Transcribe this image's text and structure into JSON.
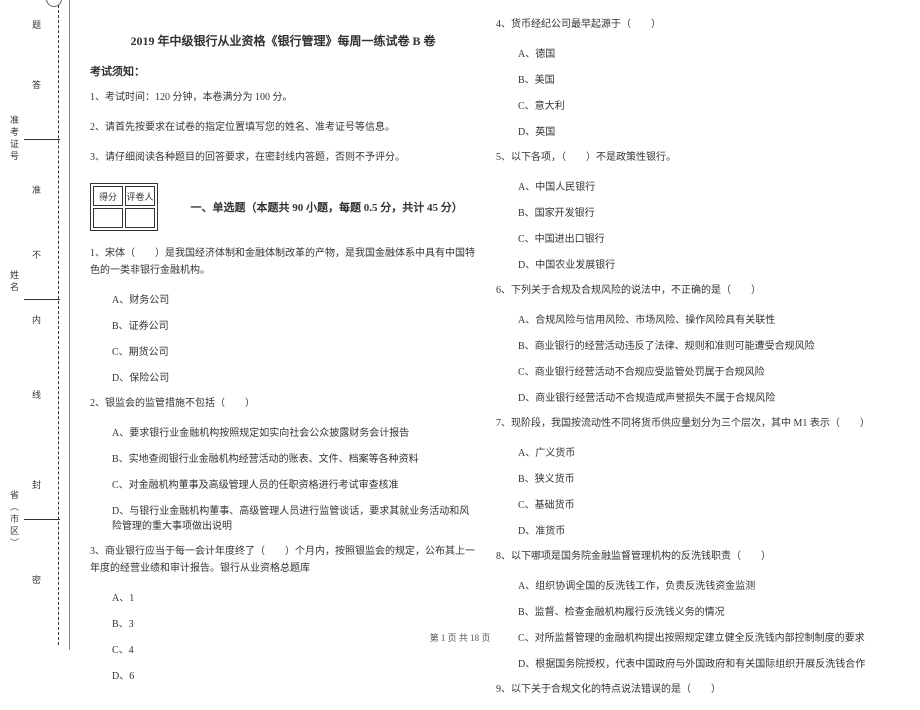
{
  "margin": {
    "field_pass": "准考证号",
    "field_name": "姓名",
    "field_region": "省（市区）",
    "seal": "密",
    "seal2": "封",
    "seal3": "线",
    "seal4": "内",
    "seal5": "不",
    "seal6": "准",
    "seal7": "答",
    "seal8": "题"
  },
  "title": "2019 年中级银行从业资格《银行管理》每周一练试卷 B 卷",
  "notice_label": "考试须知：",
  "notice1": "1、考试时间：120 分钟，本卷满分为 100 分。",
  "notice2": "2、请首先按要求在试卷的指定位置填写您的姓名、准考证号等信息。",
  "notice3": "3、请仔细阅读各种题目的回答要求，在密封线内答题，否则不予评分。",
  "score_h1": "得分",
  "score_h2": "评卷人",
  "section1": "一、单选题（本题共 90 小题，每题 0.5 分，共计 45 分）",
  "q1": "1、宋体（　　）是我国经济体制和金融体制改革的产物，是我国金融体系中具有中国特色的一类非银行金融机构。",
  "q1a": "A、财务公司",
  "q1b": "B、证券公司",
  "q1c": "C、期货公司",
  "q1d": "D、保险公司",
  "q2": "2、银监会的监管措施不包括（　　）",
  "q2a": "A、要求银行业金融机构按照规定如实向社会公众披露财务会计报告",
  "q2b": "B、实地查阅银行业金融机构经营活动的账表、文件、档案等各种资料",
  "q2c": "C、对金融机构董事及高级管理人员的任职资格进行考试审查核准",
  "q2d": "D、与银行业金融机构董事、高级管理人员进行监管谈话，要求其就业务活动和风险管理的重大事项做出说明",
  "q3": "3、商业银行应当于每一会计年度终了（　　）个月内，按照银监会的规定，公布其上一年度的经营业绩和审计报告。银行从业资格总题库",
  "q3a": "A、1",
  "q3b": "B、3",
  "q3c": "C、4",
  "q3d": "D、6",
  "q4": "4、货币经纪公司最早起源于（　　）",
  "q4a": "A、德国",
  "q4b": "B、美国",
  "q4c": "C、意大利",
  "q4d": "D、英国",
  "q5": "5、以下各项，（　　）不是政策性银行。",
  "q5a": "A、中国人民银行",
  "q5b": "B、国家开发银行",
  "q5c": "C、中国进出口银行",
  "q5d": "D、中国农业发展银行",
  "q6": "6、下列关于合规及合规风险的说法中，不正确的是（　　）",
  "q6a": "A、合规风险与信用风险、市场风险、操作风险具有关联性",
  "q6b": "B、商业银行的经营活动违反了法律、规则和准则可能遭受合规风险",
  "q6c": "C、商业银行经营活动不合规应受监管处罚属于合规风险",
  "q6d": "D、商业银行经营活动不合规造成声誉损失不属于合规风险",
  "q7": "7、现阶段，我国按流动性不同将货币供应量划分为三个层次，其中 M1 表示（　　）",
  "q7a": "A、广义货币",
  "q7b": "B、狭义货币",
  "q7c": "C、基础货币",
  "q7d": "D、准货币",
  "q8": "8、以下哪项是国务院金融监督管理机构的反洗钱职责（　　）",
  "q8a": "A、组织协调全国的反洗钱工作，负责反洗钱资金监测",
  "q8b": "B、监督、检查金融机构履行反洗钱义务的情况",
  "q8c": "C、对所监督管理的金融机构提出按照规定建立健全反洗钱内部控制制度的要求",
  "q8d": "D、根据国务院授权，代表中国政府与外国政府和有关国际组织开展反洗钱合作",
  "q9": "9、以下关于合规文化的特点说法错误的是（　　）",
  "footer": "第 1 页 共 18 页"
}
